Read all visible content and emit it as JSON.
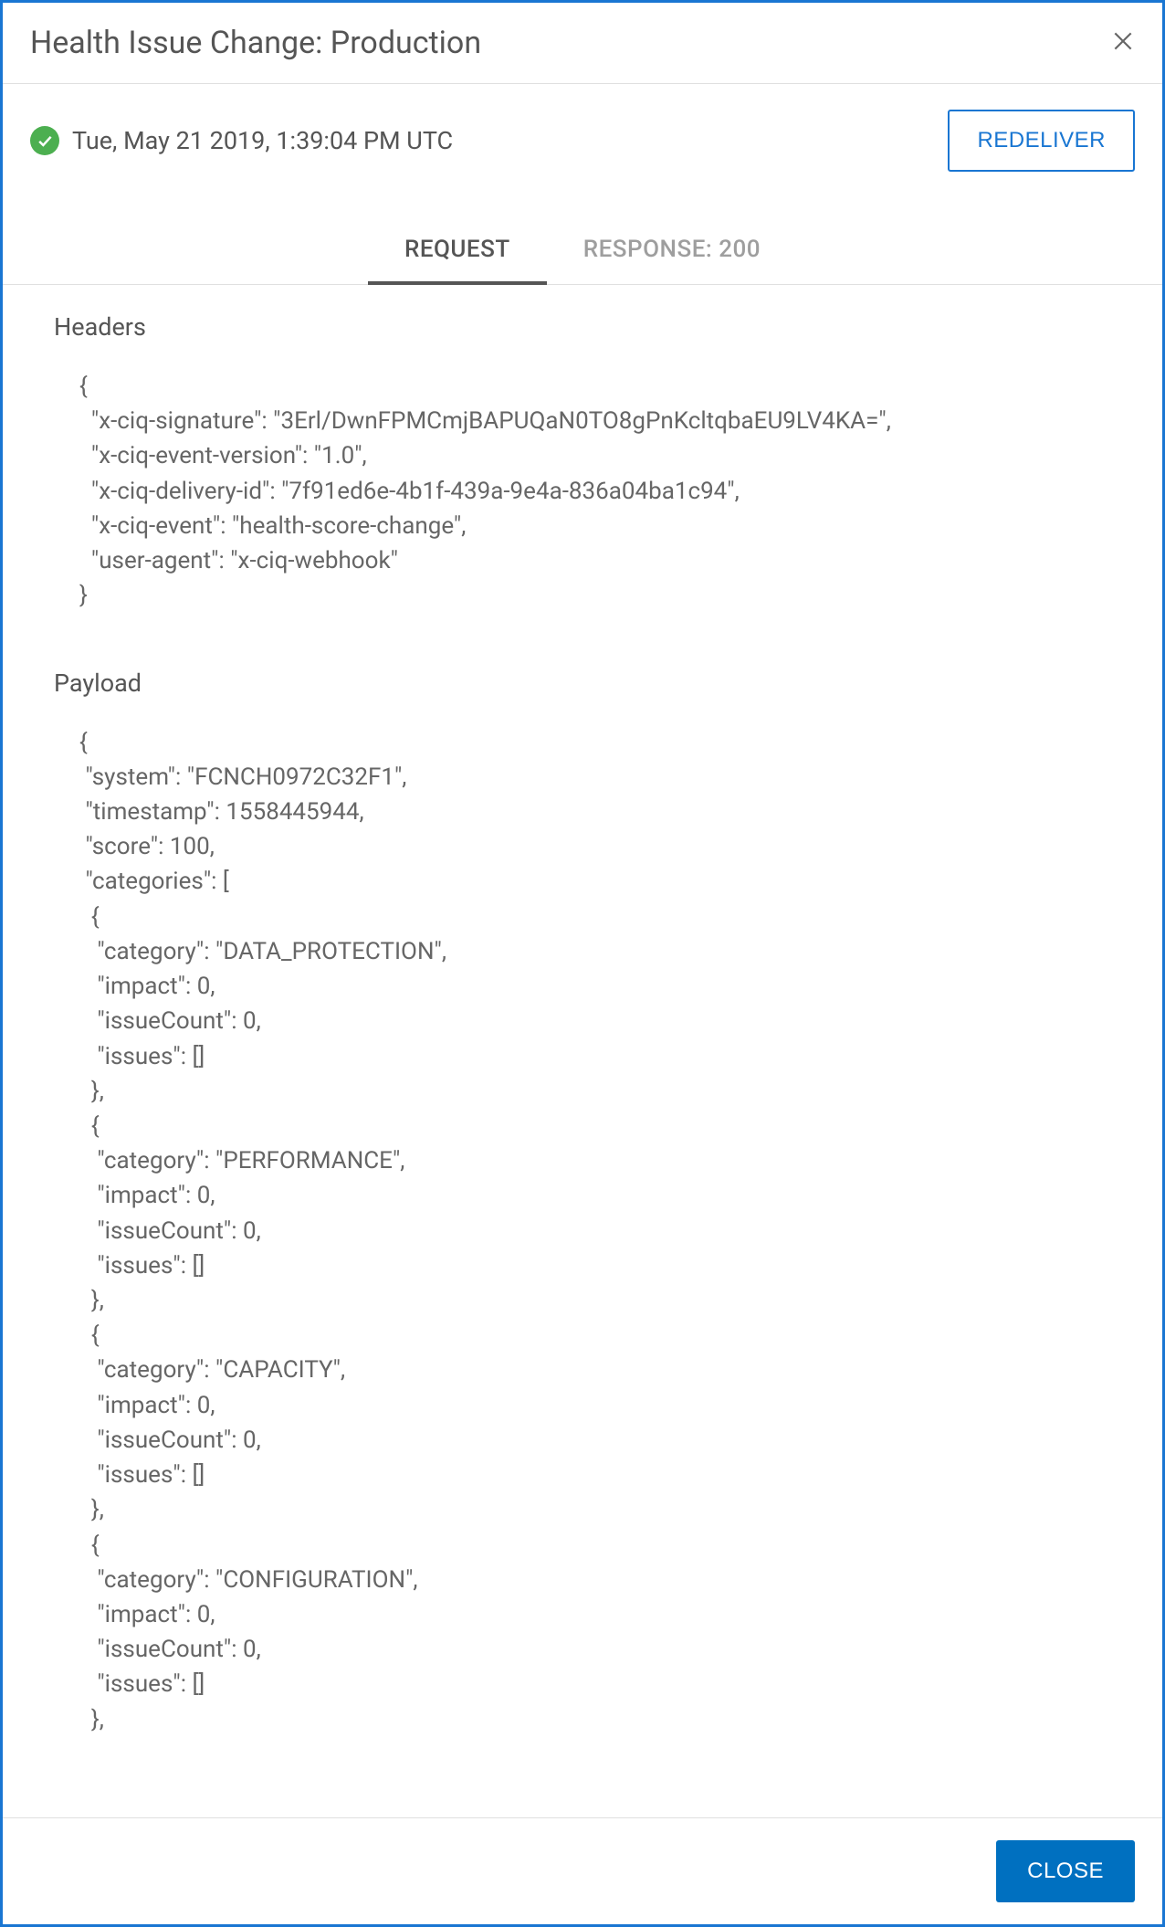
{
  "dialog": {
    "title": "Health Issue Change: Production",
    "timestamp": "Tue, May 21 2019, 1:39:04 PM UTC",
    "redeliver_label": "REDELIVER",
    "close_label": "CLOSE"
  },
  "tabs": {
    "request_label": "REQUEST",
    "response_label": "RESPONSE: 200"
  },
  "sections": {
    "headers_label": "Headers",
    "payload_label": "Payload"
  },
  "headers_code": "{\n  \"x-ciq-signature\": \"3Erl/DwnFPMCmjBAPUQaN0TO8gPnKcltqbaEU9LV4KA=\",\n  \"x-ciq-event-version\": \"1.0\",\n  \"x-ciq-delivery-id\": \"7f91ed6e-4b1f-439a-9e4a-836a04ba1c94\",\n  \"x-ciq-event\": \"health-score-change\",\n  \"user-agent\": \"x-ciq-webhook\"\n}",
  "payload_code": "{\n \"system\": \"FCNCH0972C32F1\",\n \"timestamp\": 1558445944,\n \"score\": 100,\n \"categories\": [\n  {\n   \"category\": \"DATA_PROTECTION\",\n   \"impact\": 0,\n   \"issueCount\": 0,\n   \"issues\": []\n  },\n  {\n   \"category\": \"PERFORMANCE\",\n   \"impact\": 0,\n   \"issueCount\": 0,\n   \"issues\": []\n  },\n  {\n   \"category\": \"CAPACITY\",\n   \"impact\": 0,\n   \"issueCount\": 0,\n   \"issues\": []\n  },\n  {\n   \"category\": \"CONFIGURATION\",\n   \"impact\": 0,\n   \"issueCount\": 0,\n   \"issues\": []\n  },"
}
